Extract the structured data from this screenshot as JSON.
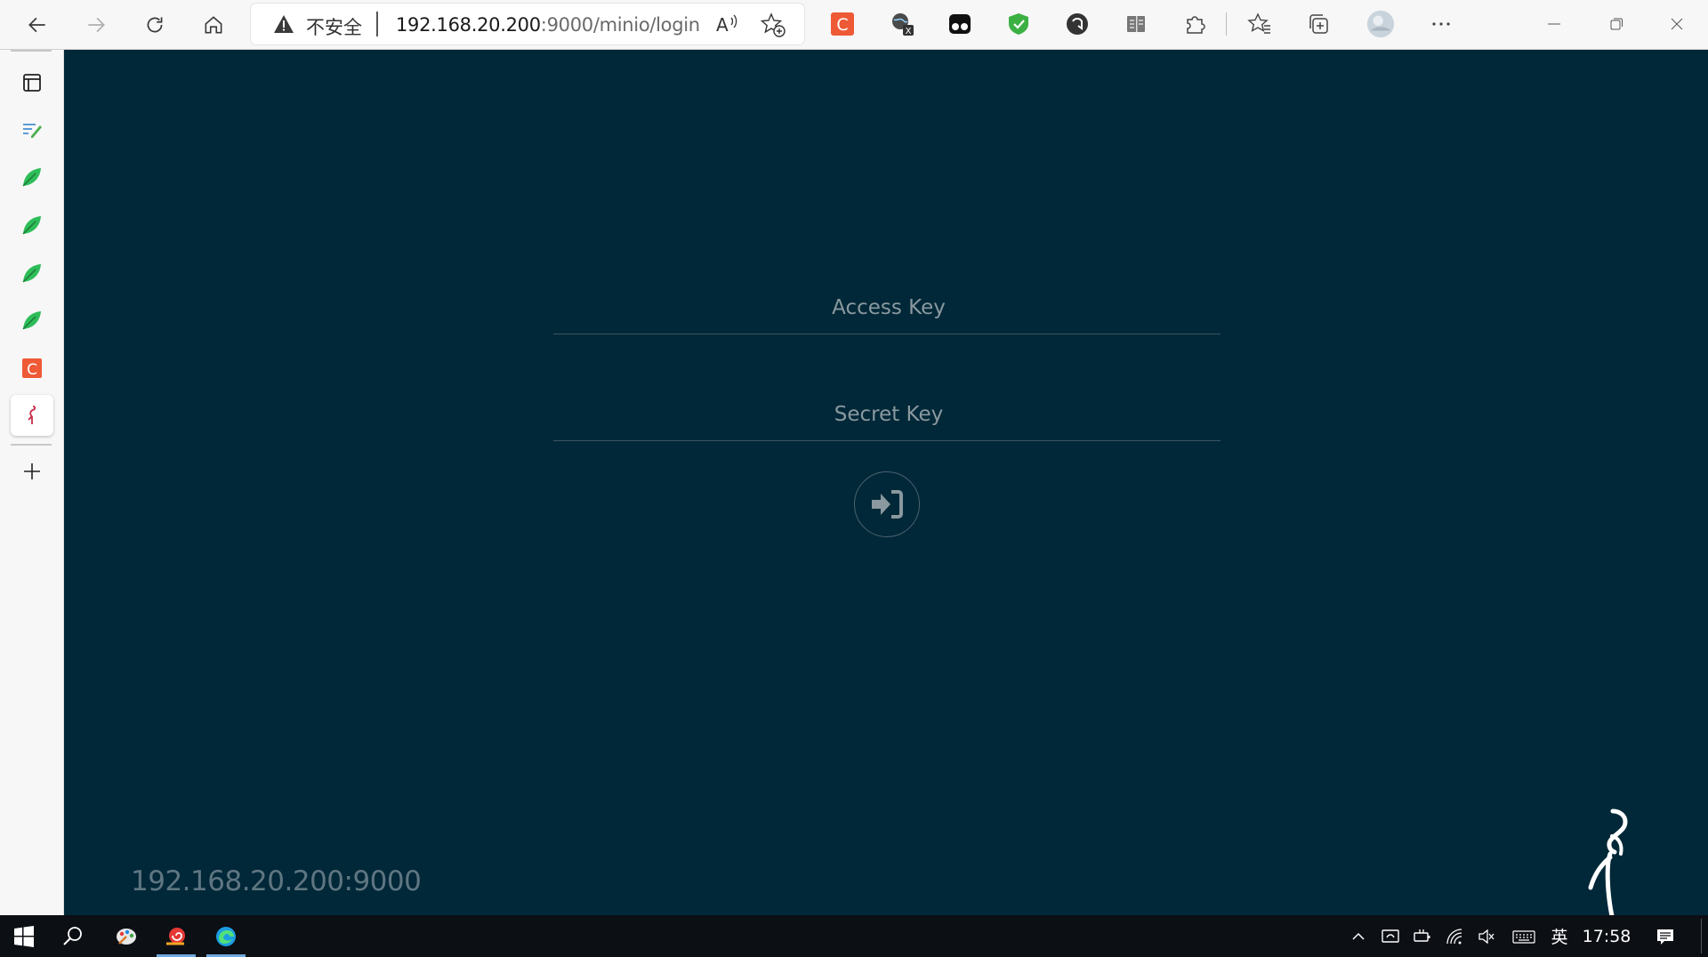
{
  "browser": {
    "security_label": "不安全",
    "url_host": "192.168.20.200",
    "url_path": ":9000/minio/login"
  },
  "colors": {
    "page_background": "#012838",
    "field_underline": "#3a5562",
    "placeholder": "#8a989f",
    "server_address_text": "#5f7682",
    "extension_red": "#ee5a36",
    "extension_green": "#3cb043",
    "sidebar_leaf_green": "#2ebd59",
    "taskbar": "#0c0f14"
  },
  "login": {
    "access_key_placeholder": "Access Key",
    "secret_key_placeholder": "Secret Key",
    "login_icon": "sign-in-icon"
  },
  "footer": {
    "server_address": "192.168.20.200:9000"
  },
  "sidebar": {
    "tabs": [
      {
        "icon": "tab-actions-icon"
      },
      {
        "icon": "note-icon"
      },
      {
        "icon": "leaf-icon"
      },
      {
        "icon": "leaf-icon"
      },
      {
        "icon": "leaf-icon"
      },
      {
        "icon": "leaf-icon"
      },
      {
        "icon": "c-logo-icon"
      },
      {
        "icon": "minio-flamingo-icon",
        "active": true
      },
      {
        "icon": "plus-icon"
      }
    ]
  },
  "taskbar": {
    "ime": "英",
    "clock": "17:58"
  }
}
